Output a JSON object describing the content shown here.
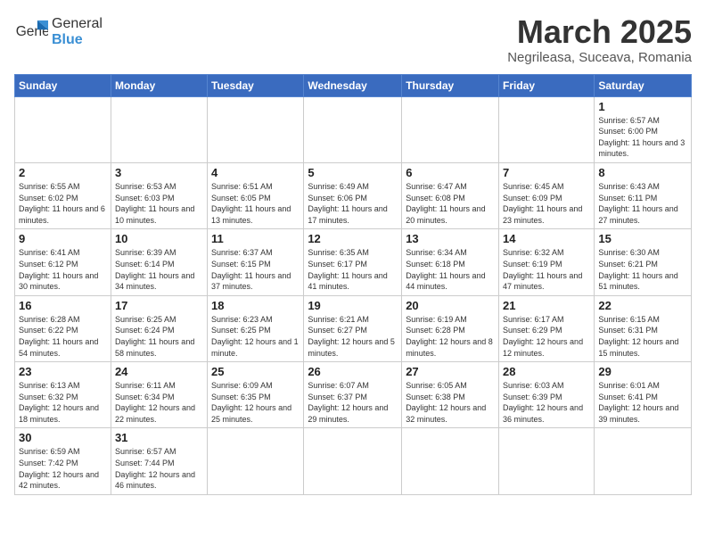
{
  "header": {
    "logo_general": "General",
    "logo_blue": "Blue",
    "month_title": "March 2025",
    "subtitle": "Negrileasa, Suceava, Romania"
  },
  "weekdays": [
    "Sunday",
    "Monday",
    "Tuesday",
    "Wednesday",
    "Thursday",
    "Friday",
    "Saturday"
  ],
  "weeks": [
    [
      {
        "day": "",
        "info": ""
      },
      {
        "day": "",
        "info": ""
      },
      {
        "day": "",
        "info": ""
      },
      {
        "day": "",
        "info": ""
      },
      {
        "day": "",
        "info": ""
      },
      {
        "day": "",
        "info": ""
      },
      {
        "day": "1",
        "info": "Sunrise: 6:57 AM\nSunset: 6:00 PM\nDaylight: 11 hours and 3 minutes."
      }
    ],
    [
      {
        "day": "2",
        "info": "Sunrise: 6:55 AM\nSunset: 6:02 PM\nDaylight: 11 hours and 6 minutes."
      },
      {
        "day": "3",
        "info": "Sunrise: 6:53 AM\nSunset: 6:03 PM\nDaylight: 11 hours and 10 minutes."
      },
      {
        "day": "4",
        "info": "Sunrise: 6:51 AM\nSunset: 6:05 PM\nDaylight: 11 hours and 13 minutes."
      },
      {
        "day": "5",
        "info": "Sunrise: 6:49 AM\nSunset: 6:06 PM\nDaylight: 11 hours and 17 minutes."
      },
      {
        "day": "6",
        "info": "Sunrise: 6:47 AM\nSunset: 6:08 PM\nDaylight: 11 hours and 20 minutes."
      },
      {
        "day": "7",
        "info": "Sunrise: 6:45 AM\nSunset: 6:09 PM\nDaylight: 11 hours and 23 minutes."
      },
      {
        "day": "8",
        "info": "Sunrise: 6:43 AM\nSunset: 6:11 PM\nDaylight: 11 hours and 27 minutes."
      }
    ],
    [
      {
        "day": "9",
        "info": "Sunrise: 6:41 AM\nSunset: 6:12 PM\nDaylight: 11 hours and 30 minutes."
      },
      {
        "day": "10",
        "info": "Sunrise: 6:39 AM\nSunset: 6:14 PM\nDaylight: 11 hours and 34 minutes."
      },
      {
        "day": "11",
        "info": "Sunrise: 6:37 AM\nSunset: 6:15 PM\nDaylight: 11 hours and 37 minutes."
      },
      {
        "day": "12",
        "info": "Sunrise: 6:35 AM\nSunset: 6:17 PM\nDaylight: 11 hours and 41 minutes."
      },
      {
        "day": "13",
        "info": "Sunrise: 6:34 AM\nSunset: 6:18 PM\nDaylight: 11 hours and 44 minutes."
      },
      {
        "day": "14",
        "info": "Sunrise: 6:32 AM\nSunset: 6:19 PM\nDaylight: 11 hours and 47 minutes."
      },
      {
        "day": "15",
        "info": "Sunrise: 6:30 AM\nSunset: 6:21 PM\nDaylight: 11 hours and 51 minutes."
      }
    ],
    [
      {
        "day": "16",
        "info": "Sunrise: 6:28 AM\nSunset: 6:22 PM\nDaylight: 11 hours and 54 minutes."
      },
      {
        "day": "17",
        "info": "Sunrise: 6:25 AM\nSunset: 6:24 PM\nDaylight: 11 hours and 58 minutes."
      },
      {
        "day": "18",
        "info": "Sunrise: 6:23 AM\nSunset: 6:25 PM\nDaylight: 12 hours and 1 minute."
      },
      {
        "day": "19",
        "info": "Sunrise: 6:21 AM\nSunset: 6:27 PM\nDaylight: 12 hours and 5 minutes."
      },
      {
        "day": "20",
        "info": "Sunrise: 6:19 AM\nSunset: 6:28 PM\nDaylight: 12 hours and 8 minutes."
      },
      {
        "day": "21",
        "info": "Sunrise: 6:17 AM\nSunset: 6:29 PM\nDaylight: 12 hours and 12 minutes."
      },
      {
        "day": "22",
        "info": "Sunrise: 6:15 AM\nSunset: 6:31 PM\nDaylight: 12 hours and 15 minutes."
      }
    ],
    [
      {
        "day": "23",
        "info": "Sunrise: 6:13 AM\nSunset: 6:32 PM\nDaylight: 12 hours and 18 minutes."
      },
      {
        "day": "24",
        "info": "Sunrise: 6:11 AM\nSunset: 6:34 PM\nDaylight: 12 hours and 22 minutes."
      },
      {
        "day": "25",
        "info": "Sunrise: 6:09 AM\nSunset: 6:35 PM\nDaylight: 12 hours and 25 minutes."
      },
      {
        "day": "26",
        "info": "Sunrise: 6:07 AM\nSunset: 6:37 PM\nDaylight: 12 hours and 29 minutes."
      },
      {
        "day": "27",
        "info": "Sunrise: 6:05 AM\nSunset: 6:38 PM\nDaylight: 12 hours and 32 minutes."
      },
      {
        "day": "28",
        "info": "Sunrise: 6:03 AM\nSunset: 6:39 PM\nDaylight: 12 hours and 36 minutes."
      },
      {
        "day": "29",
        "info": "Sunrise: 6:01 AM\nSunset: 6:41 PM\nDaylight: 12 hours and 39 minutes."
      }
    ],
    [
      {
        "day": "30",
        "info": "Sunrise: 6:59 AM\nSunset: 7:42 PM\nDaylight: 12 hours and 42 minutes."
      },
      {
        "day": "31",
        "info": "Sunrise: 6:57 AM\nSunset: 7:44 PM\nDaylight: 12 hours and 46 minutes."
      },
      {
        "day": "",
        "info": ""
      },
      {
        "day": "",
        "info": ""
      },
      {
        "day": "",
        "info": ""
      },
      {
        "day": "",
        "info": ""
      },
      {
        "day": "",
        "info": ""
      }
    ]
  ]
}
